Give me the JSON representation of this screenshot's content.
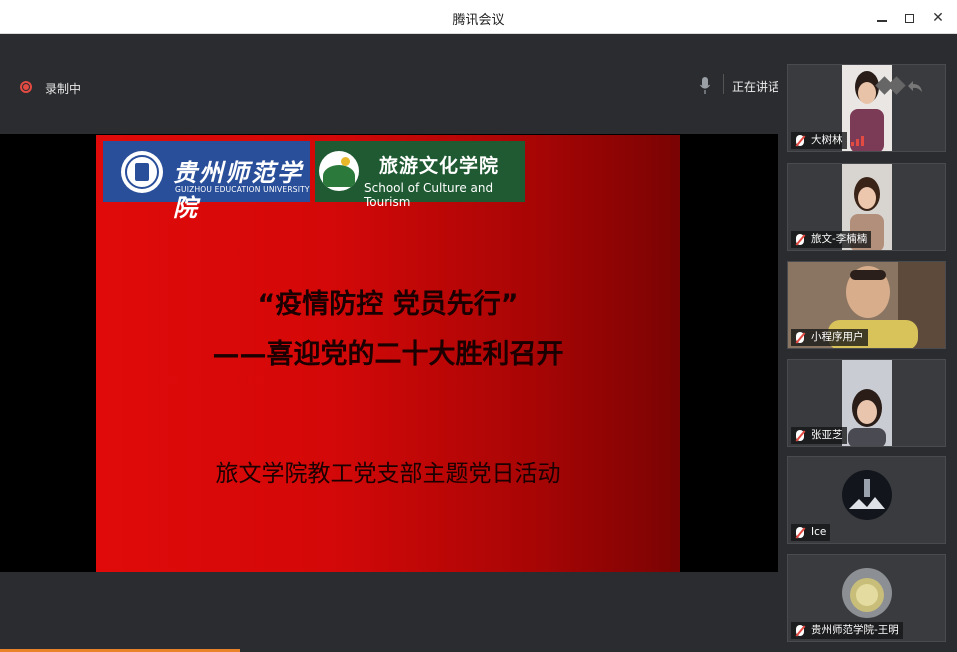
{
  "window": {
    "title": "腾讯会议"
  },
  "recording": {
    "label": "录制中"
  },
  "speaking": {
    "text": "正在讲话: 韦欣仪; 建国;"
  },
  "slide": {
    "logo1_cn": "贵州师范学院",
    "logo1_en": "GUIZHOU EDUCATION UNIVERSITY",
    "logo2_cn": "旅游文化学院",
    "logo2_en": "School of Culture and Tourism",
    "title_line1": "“疫情防控 党员先行”",
    "title_line2": "——喜迎党的二十大胜利召开",
    "subtitle": "旅文学院教工党支部主题党日活动"
  },
  "participants": [
    {
      "name": "大树林"
    },
    {
      "name": "旅文-李楠楠"
    },
    {
      "name": "小程序用户"
    },
    {
      "name": "张亚芝"
    },
    {
      "name": "Ice"
    },
    {
      "name": "贵州师范学院-王明"
    }
  ],
  "colors": {
    "record_red": "#e34a42",
    "slide_red": "#e00a0a",
    "sidebar_bg": "#2b2c2f"
  }
}
